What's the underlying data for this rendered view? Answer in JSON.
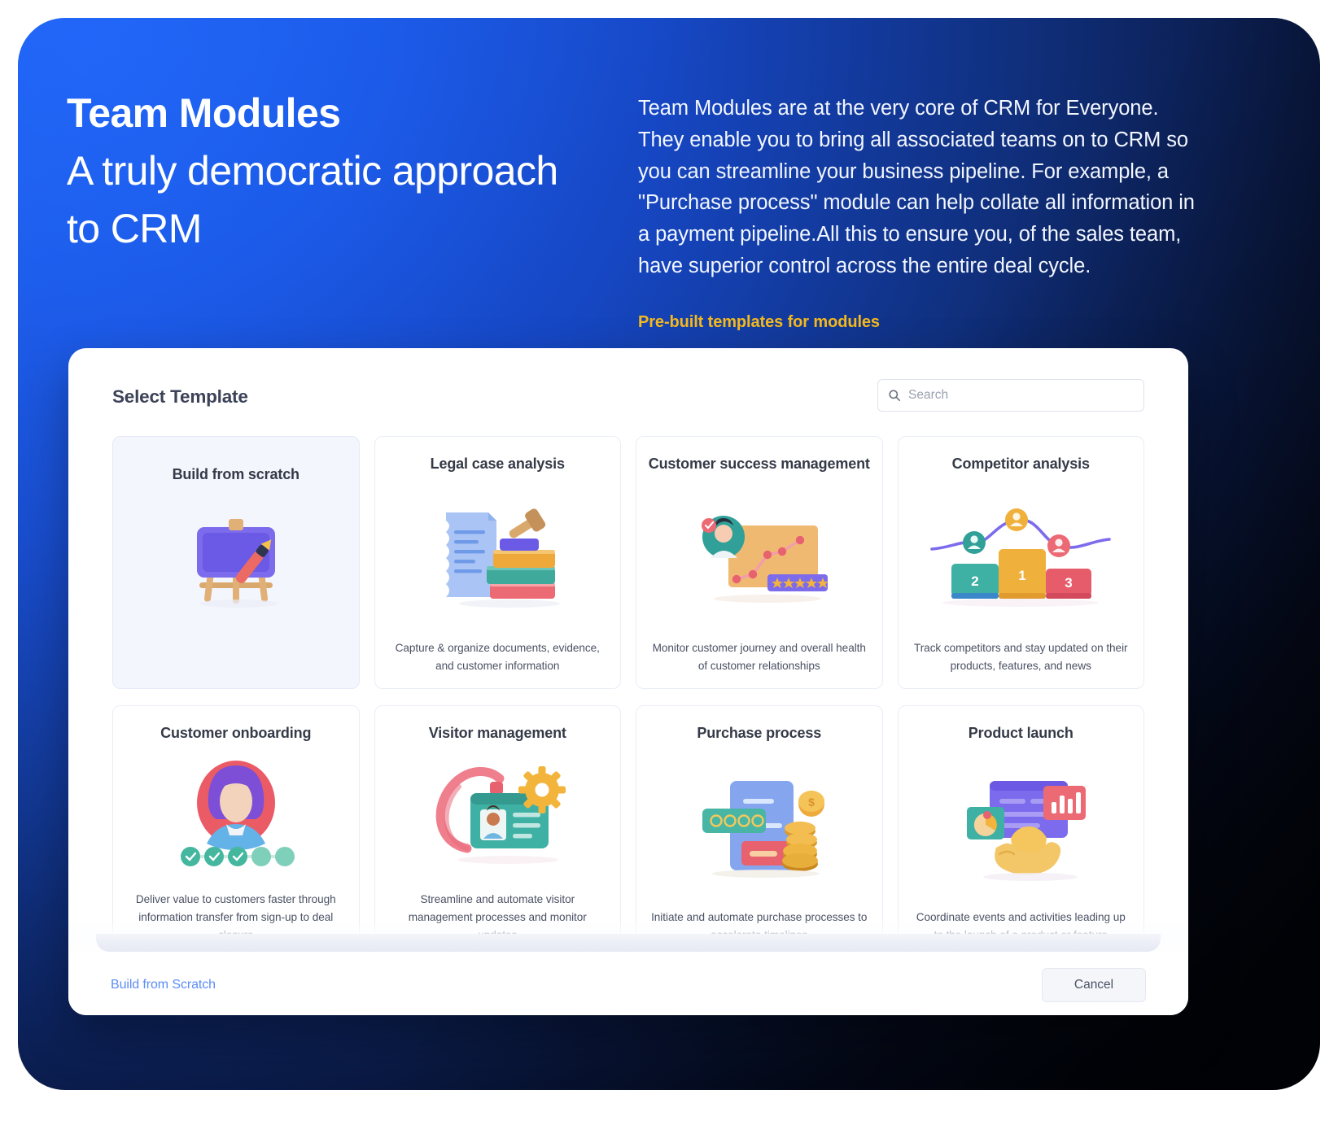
{
  "hero": {
    "title_bold": "Team Modules",
    "title_rest": "A truly democratic approach to CRM",
    "body": "Team Modules are at the very core of CRM for Everyone. They enable you to bring all associated teams on to CRM so you can streamline your business pipeline. For example, a \"Purchase process\" module can help collate all information in a payment pipeline.All this to ensure you, of the sales team, have superior control across the entire deal cycle.",
    "link": "Pre-built templates for modules",
    "link_color": "#f5b91d",
    "bg_start": "#1e63f5",
    "bg_end": "#03060f"
  },
  "dialog": {
    "title": "Select Template",
    "search": {
      "value": "",
      "placeholder": "Search",
      "icon": "search-icon"
    },
    "footer": {
      "link": "Build from Scratch",
      "link_color": "#5c8df7",
      "cancel": "Cancel"
    }
  },
  "templates": [
    {
      "title": "Build from scratch",
      "desc": "",
      "art": "easel-paintbrush",
      "selected": true
    },
    {
      "title": "Legal case analysis",
      "desc": "Capture & organize documents, evidence, and customer information",
      "art": "gavel-books-document",
      "selected": false
    },
    {
      "title": "Customer success management",
      "desc": "Monitor customer journey and overall health of customer relationships",
      "art": "chart-avatar-stars",
      "selected": false
    },
    {
      "title": "Competitor analysis",
      "desc": "Track competitors and stay updated on their products, features, and news",
      "art": "podium-line-chart",
      "selected": false
    },
    {
      "title": "Customer onboarding",
      "desc": "Deliver value to customers faster through information transfer from sign-up to deal closure",
      "art": "avatar-progress-steps",
      "selected": false
    },
    {
      "title": "Visitor management",
      "desc": "Streamline and automate visitor management processes and monitor updates",
      "art": "id-badge-gear",
      "selected": false
    },
    {
      "title": "Purchase process",
      "desc": "Initiate and automate purchase processes to accelerate timelines",
      "art": "invoice-coins-card",
      "selected": false
    },
    {
      "title": "Product launch",
      "desc": "Coordinate events and activities leading up to the launch of a product or feature",
      "art": "dashboard-rocket-hand",
      "selected": false
    }
  ]
}
